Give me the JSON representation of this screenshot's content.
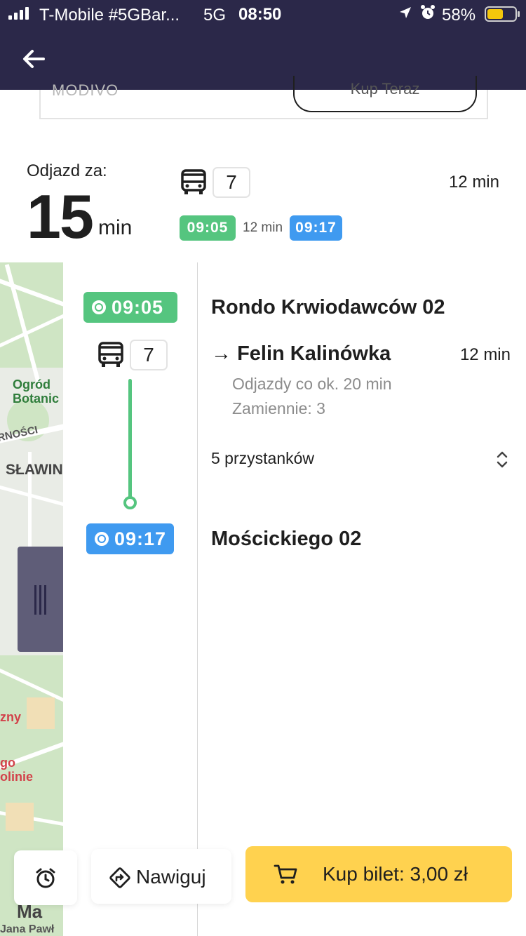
{
  "status_bar": {
    "carrier": "T-Mobile #5GBar...",
    "network": "5G",
    "time": "08:50",
    "battery": "58%",
    "battery_level": 0.58,
    "icons": [
      "signal-icon",
      "location-arrow-icon",
      "alarm-clock-icon",
      "battery-icon"
    ]
  },
  "header": {
    "back_icon": "arrow-left-icon"
  },
  "promo": {
    "provider": "MODIVO",
    "button": "Kup Teraz"
  },
  "summary": {
    "departure_label": "Odjazd za:",
    "departure_value": "15",
    "departure_unit": "min",
    "vehicle_icon": "bus-icon",
    "line": "7",
    "duration": "12 min",
    "depart_time": "09:05",
    "mid_duration": "12 min",
    "arrive_time": "09:17"
  },
  "map": {
    "labels": [
      "Ogród",
      "Botanic",
      "RNOŚCI",
      "SŁAWIN",
      "zny",
      "go",
      "olinie",
      "Ma",
      "Jana Pawł"
    ]
  },
  "route": {
    "start_time": "09:05",
    "start_stop": "Rondo Krwiodawców 02",
    "line": "7",
    "direction_arrow": "→",
    "direction": "Felin Kalinówka",
    "leg_duration": "12 min",
    "frequency": "Odjazdy co ok. 20 min",
    "alternatives": "Zamiennie:  3",
    "stops_count": "5 przystanków",
    "end_time": "09:17",
    "end_stop": "Mościckiego 02"
  },
  "actions": {
    "alarm_icon": "alarm-clock-icon",
    "navigate_label": "Nawiguj",
    "navigate_icon": "directions-icon",
    "buy_label": "Kup bilet: 3,00 zł",
    "buy_icon": "cart-icon",
    "buy_color": "#ffd24f"
  },
  "colors": {
    "header_bg": "#2b2849",
    "depart_green": "#55c57f",
    "arrive_blue": "#3f9af0"
  }
}
